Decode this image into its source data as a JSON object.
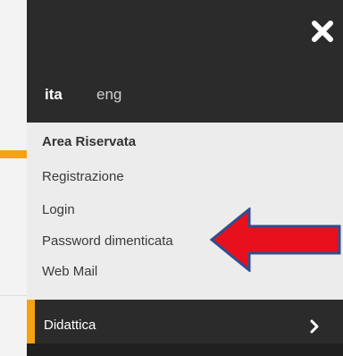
{
  "language": {
    "active": "ita",
    "other": "eng"
  },
  "menu": {
    "section_title": "Area Riservata",
    "links": [
      {
        "label": "Registrazione"
      },
      {
        "label": "Login"
      },
      {
        "label": "Password dimenticata"
      },
      {
        "label": "Web Mail"
      }
    ],
    "didattica_label": "Didattica"
  },
  "icons": {
    "close": "close-icon",
    "chevron": "chevron-right-icon",
    "annotation": "red-arrow-icon"
  },
  "colors": {
    "panel_dark": "#2b2b2b",
    "panel_light": "#ececec",
    "accent": "#f5a313",
    "arrow_fill": "#e8101c",
    "arrow_stroke": "#2f4f8f"
  }
}
